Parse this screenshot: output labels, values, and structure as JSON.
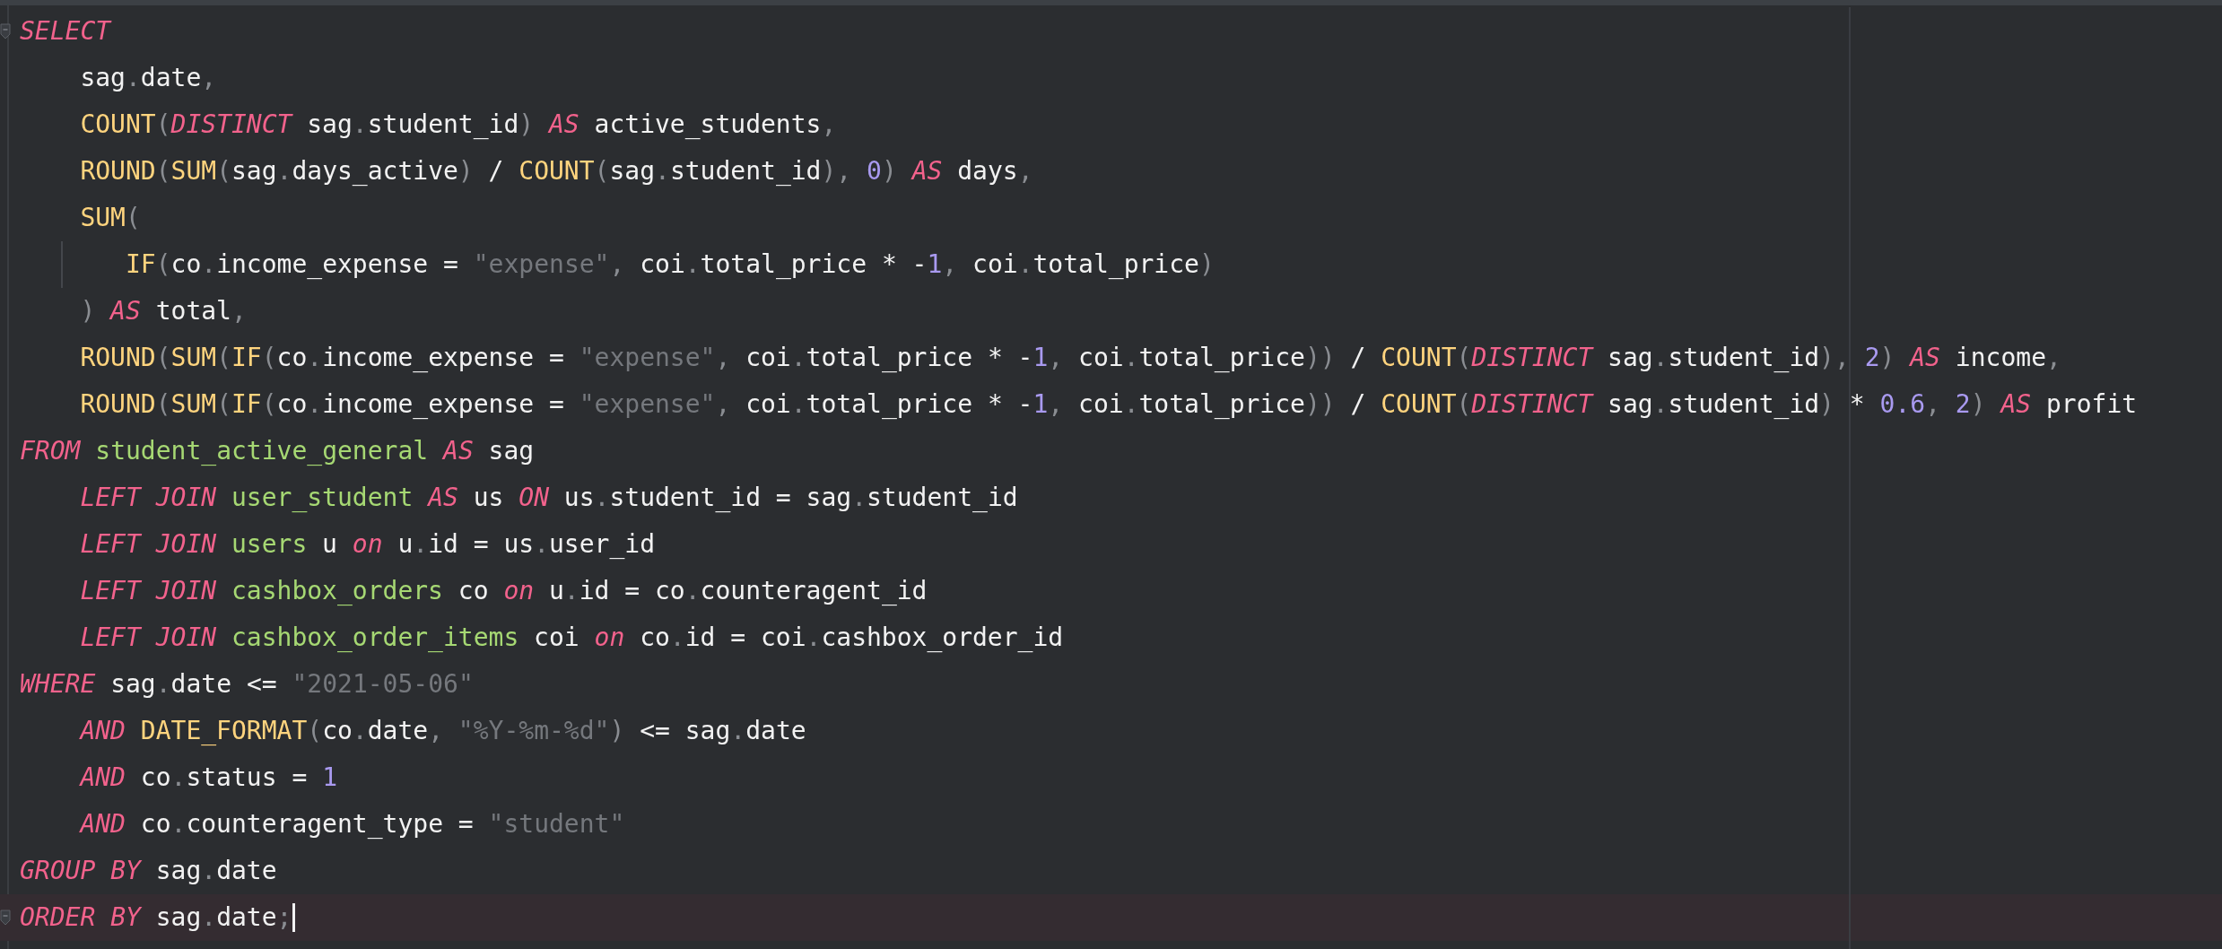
{
  "editor": {
    "lines": [
      {
        "kind": "top",
        "fold_marker": true,
        "current": false,
        "tokens": [
          {
            "kind": "keyword",
            "text": "SELECT"
          }
        ]
      },
      {
        "kind": "body",
        "fold_marker": false,
        "current": false,
        "tokens": [
          {
            "kind": "plain",
            "text": "sag"
          },
          {
            "kind": "punct",
            "text": "."
          },
          {
            "kind": "plain",
            "text": "date"
          },
          {
            "kind": "punct",
            "text": ","
          }
        ]
      },
      {
        "kind": "body",
        "fold_marker": false,
        "current": false,
        "tokens": [
          {
            "kind": "function",
            "text": "COUNT"
          },
          {
            "kind": "punct",
            "text": "("
          },
          {
            "kind": "keyword",
            "text": "DISTINCT"
          },
          {
            "kind": "plain",
            "text": " sag"
          },
          {
            "kind": "punct",
            "text": "."
          },
          {
            "kind": "plain",
            "text": "student_id"
          },
          {
            "kind": "punct",
            "text": ") "
          },
          {
            "kind": "keyword",
            "text": "AS"
          },
          {
            "kind": "plain",
            "text": " active_students"
          },
          {
            "kind": "punct",
            "text": ","
          }
        ]
      },
      {
        "kind": "body",
        "fold_marker": false,
        "current": false,
        "tokens": [
          {
            "kind": "function",
            "text": "ROUND"
          },
          {
            "kind": "punct",
            "text": "("
          },
          {
            "kind": "function",
            "text": "SUM"
          },
          {
            "kind": "punct",
            "text": "("
          },
          {
            "kind": "plain",
            "text": "sag"
          },
          {
            "kind": "punct",
            "text": "."
          },
          {
            "kind": "plain",
            "text": "days_active"
          },
          {
            "kind": "punct",
            "text": ")"
          },
          {
            "kind": "plain",
            "text": " / "
          },
          {
            "kind": "function",
            "text": "COUNT"
          },
          {
            "kind": "punct",
            "text": "("
          },
          {
            "kind": "plain",
            "text": "sag"
          },
          {
            "kind": "punct",
            "text": "."
          },
          {
            "kind": "plain",
            "text": "student_id"
          },
          {
            "kind": "punct",
            "text": "), "
          },
          {
            "kind": "number",
            "text": "0"
          },
          {
            "kind": "punct",
            "text": ") "
          },
          {
            "kind": "keyword",
            "text": "AS"
          },
          {
            "kind": "plain",
            "text": " days"
          },
          {
            "kind": "punct",
            "text": ","
          }
        ]
      },
      {
        "kind": "body",
        "fold_marker": false,
        "current": false,
        "tokens": [
          {
            "kind": "function",
            "text": "SUM"
          },
          {
            "kind": "punct",
            "text": "("
          }
        ]
      },
      {
        "kind": "nested",
        "fold_marker": false,
        "current": false,
        "tokens": [
          {
            "kind": "function",
            "text": "IF"
          },
          {
            "kind": "punct",
            "text": "("
          },
          {
            "kind": "plain",
            "text": "co"
          },
          {
            "kind": "punct",
            "text": "."
          },
          {
            "kind": "plain",
            "text": "income_expense = "
          },
          {
            "kind": "string",
            "text": "\"expense\""
          },
          {
            "kind": "punct",
            "text": ","
          },
          {
            "kind": "plain",
            "text": " coi"
          },
          {
            "kind": "punct",
            "text": "."
          },
          {
            "kind": "plain",
            "text": "total_price * -"
          },
          {
            "kind": "number",
            "text": "1"
          },
          {
            "kind": "punct",
            "text": ","
          },
          {
            "kind": "plain",
            "text": " coi"
          },
          {
            "kind": "punct",
            "text": "."
          },
          {
            "kind": "plain",
            "text": "total_price"
          },
          {
            "kind": "punct",
            "text": ")"
          }
        ]
      },
      {
        "kind": "body",
        "fold_marker": false,
        "current": false,
        "tokens": [
          {
            "kind": "punct",
            "text": ") "
          },
          {
            "kind": "keyword",
            "text": "AS"
          },
          {
            "kind": "plain",
            "text": " total"
          },
          {
            "kind": "punct",
            "text": ","
          }
        ]
      },
      {
        "kind": "body",
        "fold_marker": false,
        "current": false,
        "tokens": [
          {
            "kind": "function",
            "text": "ROUND"
          },
          {
            "kind": "punct",
            "text": "("
          },
          {
            "kind": "function",
            "text": "SUM"
          },
          {
            "kind": "punct",
            "text": "("
          },
          {
            "kind": "function",
            "text": "IF"
          },
          {
            "kind": "punct",
            "text": "("
          },
          {
            "kind": "plain",
            "text": "co"
          },
          {
            "kind": "punct",
            "text": "."
          },
          {
            "kind": "plain",
            "text": "income_expense = "
          },
          {
            "kind": "string",
            "text": "\"expense\""
          },
          {
            "kind": "punct",
            "text": ","
          },
          {
            "kind": "plain",
            "text": " coi"
          },
          {
            "kind": "punct",
            "text": "."
          },
          {
            "kind": "plain",
            "text": "total_price * -"
          },
          {
            "kind": "number",
            "text": "1"
          },
          {
            "kind": "punct",
            "text": ","
          },
          {
            "kind": "plain",
            "text": " coi"
          },
          {
            "kind": "punct",
            "text": "."
          },
          {
            "kind": "plain",
            "text": "total_price"
          },
          {
            "kind": "punct",
            "text": "))"
          },
          {
            "kind": "plain",
            "text": " / "
          },
          {
            "kind": "function",
            "text": "COUNT"
          },
          {
            "kind": "punct",
            "text": "("
          },
          {
            "kind": "keyword",
            "text": "DISTINCT"
          },
          {
            "kind": "plain",
            "text": " sag"
          },
          {
            "kind": "punct",
            "text": "."
          },
          {
            "kind": "plain",
            "text": "student_id"
          },
          {
            "kind": "punct",
            "text": "), "
          },
          {
            "kind": "number",
            "text": "2"
          },
          {
            "kind": "punct",
            "text": ") "
          },
          {
            "kind": "keyword",
            "text": "AS"
          },
          {
            "kind": "plain",
            "text": " income"
          },
          {
            "kind": "punct",
            "text": ","
          }
        ]
      },
      {
        "kind": "body",
        "fold_marker": false,
        "current": false,
        "tokens": [
          {
            "kind": "function",
            "text": "ROUND"
          },
          {
            "kind": "punct",
            "text": "("
          },
          {
            "kind": "function",
            "text": "SUM"
          },
          {
            "kind": "punct",
            "text": "("
          },
          {
            "kind": "function",
            "text": "IF"
          },
          {
            "kind": "punct",
            "text": "("
          },
          {
            "kind": "plain",
            "text": "co"
          },
          {
            "kind": "punct",
            "text": "."
          },
          {
            "kind": "plain",
            "text": "income_expense = "
          },
          {
            "kind": "string",
            "text": "\"expense\""
          },
          {
            "kind": "punct",
            "text": ","
          },
          {
            "kind": "plain",
            "text": " coi"
          },
          {
            "kind": "punct",
            "text": "."
          },
          {
            "kind": "plain",
            "text": "total_price * -"
          },
          {
            "kind": "number",
            "text": "1"
          },
          {
            "kind": "punct",
            "text": ","
          },
          {
            "kind": "plain",
            "text": " coi"
          },
          {
            "kind": "punct",
            "text": "."
          },
          {
            "kind": "plain",
            "text": "total_price"
          },
          {
            "kind": "punct",
            "text": "))"
          },
          {
            "kind": "plain",
            "text": " / "
          },
          {
            "kind": "function",
            "text": "COUNT"
          },
          {
            "kind": "punct",
            "text": "("
          },
          {
            "kind": "keyword",
            "text": "DISTINCT"
          },
          {
            "kind": "plain",
            "text": " sag"
          },
          {
            "kind": "punct",
            "text": "."
          },
          {
            "kind": "plain",
            "text": "student_id"
          },
          {
            "kind": "punct",
            "text": ")"
          },
          {
            "kind": "plain",
            "text": " * "
          },
          {
            "kind": "number",
            "text": "0.6"
          },
          {
            "kind": "punct",
            "text": ", "
          },
          {
            "kind": "number",
            "text": "2"
          },
          {
            "kind": "punct",
            "text": ") "
          },
          {
            "kind": "keyword",
            "text": "AS"
          },
          {
            "kind": "plain",
            "text": " profit"
          }
        ]
      },
      {
        "kind": "top",
        "fold_marker": false,
        "current": false,
        "tokens": [
          {
            "kind": "keyword",
            "text": "FROM "
          },
          {
            "kind": "table",
            "text": "student_active_general "
          },
          {
            "kind": "keyword",
            "text": "AS"
          },
          {
            "kind": "plain",
            "text": " sag"
          }
        ]
      },
      {
        "kind": "body",
        "fold_marker": false,
        "current": false,
        "tokens": [
          {
            "kind": "keyword",
            "text": "LEFT JOIN "
          },
          {
            "kind": "table",
            "text": "user_student "
          },
          {
            "kind": "keyword",
            "text": "AS"
          },
          {
            "kind": "plain",
            "text": " us "
          },
          {
            "kind": "keyword",
            "text": "ON"
          },
          {
            "kind": "plain",
            "text": " us"
          },
          {
            "kind": "punct",
            "text": "."
          },
          {
            "kind": "plain",
            "text": "student_id = sag"
          },
          {
            "kind": "punct",
            "text": "."
          },
          {
            "kind": "plain",
            "text": "student_id"
          }
        ]
      },
      {
        "kind": "body",
        "fold_marker": false,
        "current": false,
        "tokens": [
          {
            "kind": "keyword",
            "text": "LEFT JOIN "
          },
          {
            "kind": "table",
            "text": "users"
          },
          {
            "kind": "plain",
            "text": " u "
          },
          {
            "kind": "keyword",
            "text": "on"
          },
          {
            "kind": "plain",
            "text": " u"
          },
          {
            "kind": "punct",
            "text": "."
          },
          {
            "kind": "plain",
            "text": "id = us"
          },
          {
            "kind": "punct",
            "text": "."
          },
          {
            "kind": "plain",
            "text": "user_id"
          }
        ]
      },
      {
        "kind": "body",
        "fold_marker": false,
        "current": false,
        "tokens": [
          {
            "kind": "keyword",
            "text": "LEFT JOIN "
          },
          {
            "kind": "table",
            "text": "cashbox_orders"
          },
          {
            "kind": "plain",
            "text": " co "
          },
          {
            "kind": "keyword",
            "text": "on"
          },
          {
            "kind": "plain",
            "text": " u"
          },
          {
            "kind": "punct",
            "text": "."
          },
          {
            "kind": "plain",
            "text": "id = co"
          },
          {
            "kind": "punct",
            "text": "."
          },
          {
            "kind": "plain",
            "text": "counteragent_id"
          }
        ]
      },
      {
        "kind": "body",
        "fold_marker": false,
        "current": false,
        "tokens": [
          {
            "kind": "keyword",
            "text": "LEFT JOIN "
          },
          {
            "kind": "table",
            "text": "cashbox_order_items"
          },
          {
            "kind": "plain",
            "text": " coi "
          },
          {
            "kind": "keyword",
            "text": "on"
          },
          {
            "kind": "plain",
            "text": " co"
          },
          {
            "kind": "punct",
            "text": "."
          },
          {
            "kind": "plain",
            "text": "id = coi"
          },
          {
            "kind": "punct",
            "text": "."
          },
          {
            "kind": "plain",
            "text": "cashbox_order_id"
          }
        ]
      },
      {
        "kind": "top",
        "fold_marker": false,
        "current": false,
        "tokens": [
          {
            "kind": "keyword",
            "text": "WHERE"
          },
          {
            "kind": "plain",
            "text": " sag"
          },
          {
            "kind": "punct",
            "text": "."
          },
          {
            "kind": "plain",
            "text": "date <= "
          },
          {
            "kind": "string",
            "text": "\"2021-05-06\""
          }
        ]
      },
      {
        "kind": "body",
        "fold_marker": false,
        "current": false,
        "tokens": [
          {
            "kind": "keyword",
            "text": "AND "
          },
          {
            "kind": "function",
            "text": "DATE_FORMAT"
          },
          {
            "kind": "punct",
            "text": "("
          },
          {
            "kind": "plain",
            "text": "co"
          },
          {
            "kind": "punct",
            "text": "."
          },
          {
            "kind": "plain",
            "text": "date"
          },
          {
            "kind": "punct",
            "text": ", "
          },
          {
            "kind": "string",
            "text": "\"%Y-%m-%d\""
          },
          {
            "kind": "punct",
            "text": ")"
          },
          {
            "kind": "plain",
            "text": " <= sag"
          },
          {
            "kind": "punct",
            "text": "."
          },
          {
            "kind": "plain",
            "text": "date"
          }
        ]
      },
      {
        "kind": "body",
        "fold_marker": false,
        "current": false,
        "tokens": [
          {
            "kind": "keyword",
            "text": "AND"
          },
          {
            "kind": "plain",
            "text": " co"
          },
          {
            "kind": "punct",
            "text": "."
          },
          {
            "kind": "plain",
            "text": "status = "
          },
          {
            "kind": "number",
            "text": "1"
          }
        ]
      },
      {
        "kind": "body",
        "fold_marker": false,
        "current": false,
        "tokens": [
          {
            "kind": "keyword",
            "text": "AND"
          },
          {
            "kind": "plain",
            "text": " co"
          },
          {
            "kind": "punct",
            "text": "."
          },
          {
            "kind": "plain",
            "text": "counteragent_type = "
          },
          {
            "kind": "string",
            "text": "\"student\""
          }
        ]
      },
      {
        "kind": "top",
        "fold_marker": false,
        "current": false,
        "tokens": [
          {
            "kind": "keyword",
            "text": "GROUP BY"
          },
          {
            "kind": "plain",
            "text": " sag"
          },
          {
            "kind": "punct",
            "text": "."
          },
          {
            "kind": "plain",
            "text": "date"
          }
        ]
      },
      {
        "kind": "top",
        "fold_marker": true,
        "current": true,
        "tokens": [
          {
            "kind": "keyword",
            "text": "ORDER BY"
          },
          {
            "kind": "plain",
            "text": " sag"
          },
          {
            "kind": "punct",
            "text": "."
          },
          {
            "kind": "plain",
            "text": "date"
          },
          {
            "kind": "punct",
            "text": ";"
          }
        ]
      }
    ]
  }
}
